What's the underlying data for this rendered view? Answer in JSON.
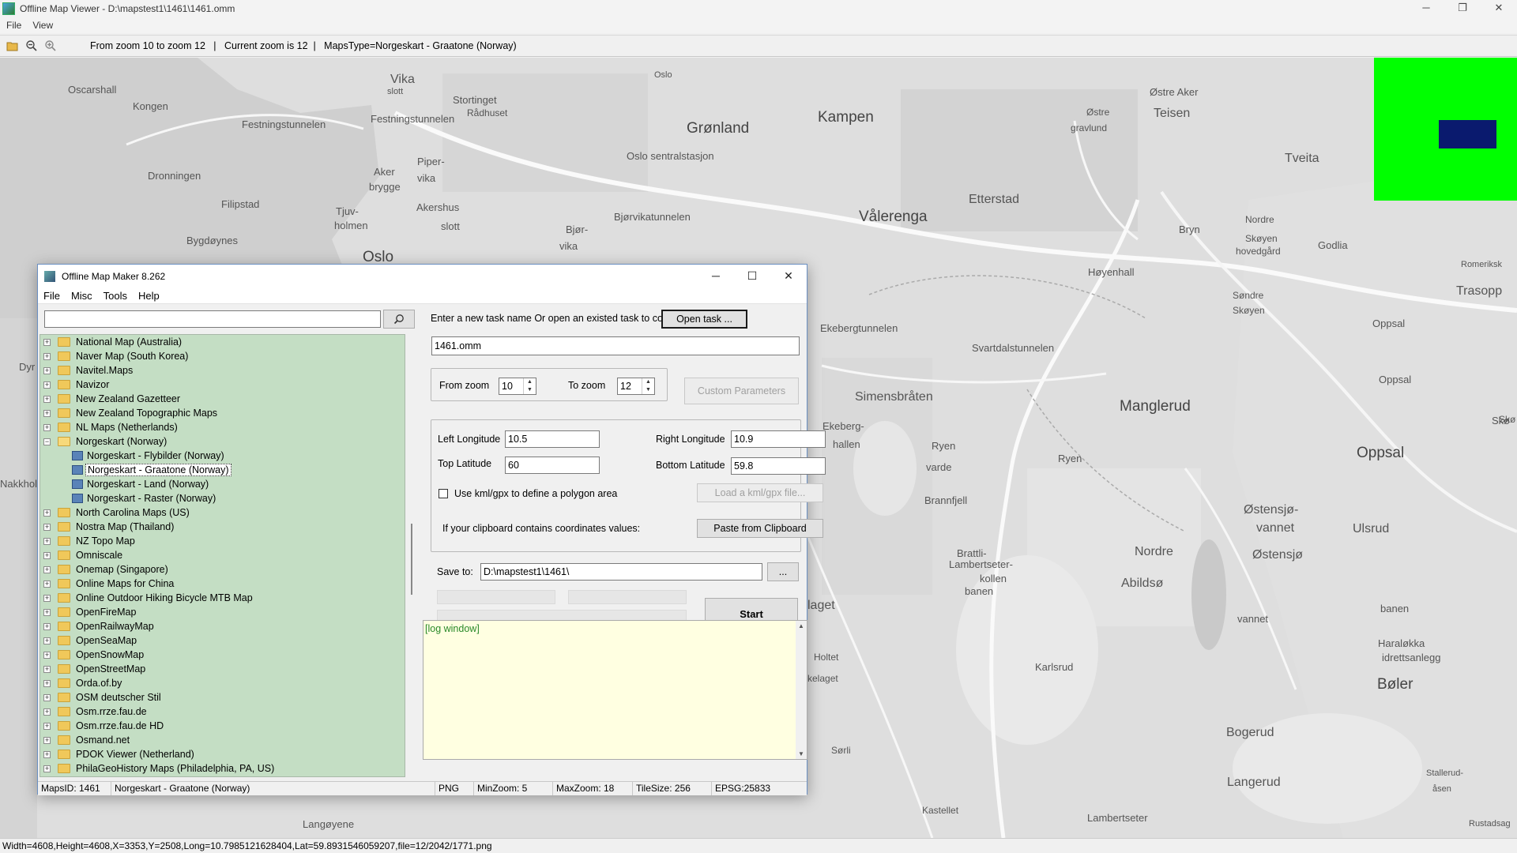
{
  "window": {
    "title": "Offline Map Viewer - D:\\mapstest1\\1461\\1461.omm",
    "controls": [
      "─",
      "❐",
      "✕"
    ]
  },
  "menu": [
    "File",
    "View"
  ],
  "toolbar": {
    "info": "From zoom 10 to zoom 12   |   Current zoom is 12  |   MapsType=Norgeskart - Graatone (Norway)"
  },
  "map": {
    "labels": [
      {
        "text": "Oscarshall",
        "cls": ""
      },
      {
        "text": "Kongen",
        "cls": ""
      },
      {
        "text": "Dronningen",
        "cls": ""
      },
      {
        "text": "Filipstad",
        "cls": ""
      },
      {
        "text": "Bygdøynes",
        "cls": ""
      },
      {
        "text": "Festningstunnelen",
        "cls": ""
      },
      {
        "text": "Vika",
        "cls": "mid"
      },
      {
        "text": "slott",
        "cls": ""
      },
      {
        "text": "Stortinget",
        "cls": ""
      },
      {
        "text": "Rådhuset",
        "cls": ""
      },
      {
        "text": "Festningstunnelen",
        "cls": ""
      },
      {
        "text": "Aker",
        "cls": ""
      },
      {
        "text": "brygge",
        "cls": ""
      },
      {
        "text": "Piper-",
        "cls": ""
      },
      {
        "text": "vika",
        "cls": ""
      },
      {
        "text": "Tjuv-",
        "cls": ""
      },
      {
        "text": "holmen",
        "cls": ""
      },
      {
        "text": "Akershus",
        "cls": ""
      },
      {
        "text": "slott",
        "cls": ""
      },
      {
        "text": "Oslo",
        "cls": "big"
      },
      {
        "text": "Oslo",
        "cls": ""
      },
      {
        "text": "Grønland",
        "cls": "big"
      },
      {
        "text": "Oslo sentralstasjon",
        "cls": ""
      },
      {
        "text": "Bjørvikatunnelen",
        "cls": ""
      },
      {
        "text": "Bjør-",
        "cls": ""
      },
      {
        "text": "vika",
        "cls": ""
      },
      {
        "text": "Kampen",
        "cls": "big"
      },
      {
        "text": "Vålerenga",
        "cls": "big"
      },
      {
        "text": "Etterstad",
        "cls": "mid"
      },
      {
        "text": "Østre Aker",
        "cls": ""
      },
      {
        "text": "Østre",
        "cls": ""
      },
      {
        "text": "gravlund",
        "cls": ""
      },
      {
        "text": "Teisen",
        "cls": "mid"
      },
      {
        "text": "Tveita",
        "cls": "mid"
      },
      {
        "text": "Bryn",
        "cls": ""
      },
      {
        "text": "Nordre",
        "cls": ""
      },
      {
        "text": "Skøyen",
        "cls": ""
      },
      {
        "text": "hovedgård",
        "cls": ""
      },
      {
        "text": "Godlia",
        "cls": ""
      },
      {
        "text": "Romeriksk",
        "cls": ""
      },
      {
        "text": "Trasopp",
        "cls": "mid"
      },
      {
        "text": "Høyenhall",
        "cls": ""
      },
      {
        "text": "Søndre",
        "cls": ""
      },
      {
        "text": "Skøyen",
        "cls": ""
      },
      {
        "text": "Oppsal",
        "cls": ""
      },
      {
        "text": "Oppsal",
        "cls": ""
      },
      {
        "text": "Ekebergtunnelen",
        "cls": ""
      },
      {
        "text": "Svartdalstunnelen",
        "cls": ""
      },
      {
        "text": "Simensbråten",
        "cls": "mid"
      },
      {
        "text": "Manglerud",
        "cls": "big"
      },
      {
        "text": "Oppsal",
        "cls": "big"
      },
      {
        "text": "Skø",
        "cls": ""
      },
      {
        "text": "Ryen",
        "cls": ""
      },
      {
        "text": "varde",
        "cls": ""
      },
      {
        "text": "Ekeberg-",
        "cls": ""
      },
      {
        "text": "hallen",
        "cls": ""
      },
      {
        "text": "Ryen",
        "cls": ""
      },
      {
        "text": "Brannfjell",
        "cls": ""
      },
      {
        "text": "Brattli-",
        "cls": ""
      },
      {
        "text": "Lambertseter-",
        "cls": ""
      },
      {
        "text": "kollen",
        "cls": ""
      },
      {
        "text": "Nordre",
        "cls": "mid"
      },
      {
        "text": "Abildsø",
        "cls": "mid"
      },
      {
        "text": "Østensjø-",
        "cls": "mid"
      },
      {
        "text": "vannet",
        "cls": "mid"
      },
      {
        "text": "Ulsrud",
        "cls": "mid"
      },
      {
        "text": "Østensjø",
        "cls": "mid"
      },
      {
        "text": "banen",
        "cls": ""
      },
      {
        "text": "banen",
        "cls": ""
      },
      {
        "text": "vannet",
        "cls": ""
      },
      {
        "text": "Haraløkka",
        "cls": ""
      },
      {
        "text": "idrettsanlegg",
        "cls": ""
      },
      {
        "text": "Bøler",
        "cls": "big"
      },
      {
        "text": "Bogerud",
        "cls": "mid"
      },
      {
        "text": "Karlsrud",
        "cls": ""
      },
      {
        "text": "Langerud",
        "cls": "mid"
      },
      {
        "text": "Stallerud-",
        "cls": ""
      },
      {
        "text": "åsen",
        "cls": ""
      },
      {
        "text": "Lambertseter",
        "cls": ""
      },
      {
        "text": "Rustadsag",
        "cls": ""
      },
      {
        "text": "Kastellet",
        "cls": ""
      },
      {
        "text": "Langøyene",
        "cls": ""
      },
      {
        "text": "Dyr",
        "cls": ""
      },
      {
        "text": "Nakkhol",
        "cls": ""
      },
      {
        "text": "Holtet",
        "cls": ""
      },
      {
        "text": "kelaget",
        "cls": ""
      },
      {
        "text": "laget",
        "cls": "mid"
      },
      {
        "text": "Sørli",
        "cls": ""
      },
      {
        "text": "Skø",
        "cls": ""
      }
    ]
  },
  "statusbar": {
    "text": "Width=4608,Height=4608,X=3353,Y=2508,Long=10.7985121628404,Lat=59.8931546059207,file=12/2042/1771.png"
  },
  "dialog": {
    "title": "Offline Map Maker 8.262",
    "controls": [
      "─",
      "☐",
      "✕"
    ],
    "menu": [
      "File",
      "Misc",
      "Tools",
      "Help"
    ],
    "search": {
      "value": ""
    },
    "tree": [
      {
        "label": "National Map (Australia)",
        "type": "folder"
      },
      {
        "label": "Naver Map (South Korea)",
        "type": "folder"
      },
      {
        "label": "Navitel.Maps",
        "type": "folder"
      },
      {
        "label": "Navizor",
        "type": "folder"
      },
      {
        "label": "New Zealand Gazetteer",
        "type": "folder"
      },
      {
        "label": "New Zealand Topographic Maps",
        "type": "folder"
      },
      {
        "label": "NL Maps (Netherlands)",
        "type": "folder"
      },
      {
        "label": "Norgeskart (Norway)",
        "type": "open"
      },
      {
        "label": "Norgeskart - Flybilder (Norway)",
        "type": "leaf"
      },
      {
        "label": "Norgeskart - Graatone (Norway)",
        "type": "leaf",
        "selected": true
      },
      {
        "label": "Norgeskart - Land (Norway)",
        "type": "leaf"
      },
      {
        "label": "Norgeskart - Raster (Norway)",
        "type": "leaf"
      },
      {
        "label": "North Carolina Maps (US)",
        "type": "folder"
      },
      {
        "label": "Nostra Map (Thailand)",
        "type": "folder"
      },
      {
        "label": "NZ Topo Map",
        "type": "folder"
      },
      {
        "label": "Omniscale",
        "type": "folder"
      },
      {
        "label": "Onemap (Singapore)",
        "type": "folder"
      },
      {
        "label": "Online Maps for China",
        "type": "folder"
      },
      {
        "label": "Online Outdoor Hiking Bicycle MTB Map",
        "type": "folder"
      },
      {
        "label": "OpenFireMap",
        "type": "folder"
      },
      {
        "label": "OpenRailwayMap",
        "type": "folder"
      },
      {
        "label": "OpenSeaMap",
        "type": "folder"
      },
      {
        "label": "OpenSnowMap",
        "type": "folder"
      },
      {
        "label": "OpenStreetMap",
        "type": "folder"
      },
      {
        "label": "Orda.of.by",
        "type": "folder"
      },
      {
        "label": "OSM deutscher Stil",
        "type": "folder"
      },
      {
        "label": "Osm.rrze.fau.de",
        "type": "folder"
      },
      {
        "label": "Osm.rrze.fau.de HD",
        "type": "folder"
      },
      {
        "label": "Osmand.net",
        "type": "folder"
      },
      {
        "label": "PDOK Viewer (Netherland)",
        "type": "folder"
      },
      {
        "label": "PhilaGeoHistory Maps (Philadelphia, PA, US)",
        "type": "folder"
      }
    ],
    "task_prompt": "Enter a new task name Or open an existed task to continue:",
    "open_task_label": "Open task ...",
    "task_name": "1461.omm",
    "from_zoom_label": "From zoom",
    "from_zoom": "10",
    "to_zoom_label": "To zoom",
    "to_zoom": "12",
    "custom_params_label": "Custom Parameters",
    "left_lon_label": "Left Longitude",
    "left_lon": "10.5",
    "right_lon_label": "Right Longitude",
    "right_lon": "10.9",
    "top_lat_label": "Top Latitude",
    "top_lat": "60",
    "bottom_lat_label": "Bottom Latitude",
    "bottom_lat": "59.8",
    "kml_label": "Use kml/gpx to define a polygon area",
    "load_kml_label": "Load a kml/gpx file...",
    "clipboard_prompt": "If your clipboard contains coordinates values:",
    "paste_label": "Paste from Clipboard",
    "save_to_label": "Save to:",
    "save_to": "D:\\mapstest1\\1461\\",
    "browse_label": "...",
    "start_label": "Start",
    "log_text": "[log window]",
    "status": {
      "maps_id": "MapsID: 1461",
      "maps_name": "Norgeskart - Graatone (Norway)",
      "format": "PNG",
      "min_zoom": "MinZoom: 5",
      "max_zoom": "MaxZoom: 18",
      "tile_size": "TileSize: 256",
      "epsg": "EPSG:25833"
    }
  }
}
